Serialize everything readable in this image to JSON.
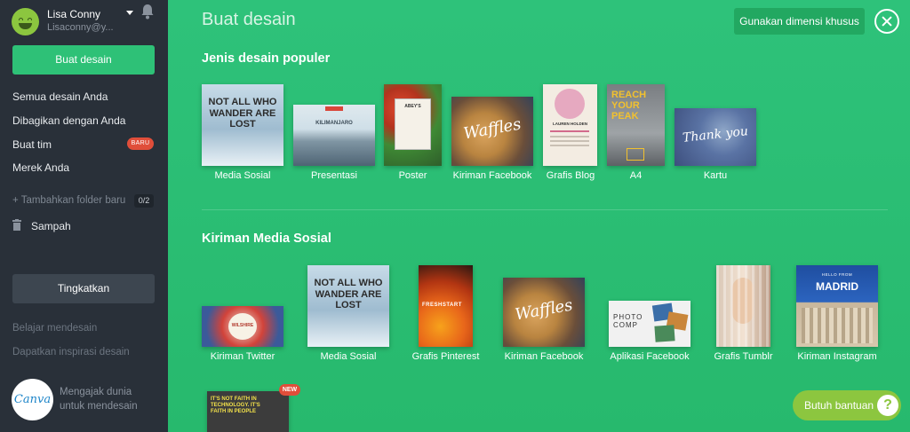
{
  "sidebar": {
    "user": {
      "name": "Lisa Conny",
      "email": "Lisaconny@y..."
    },
    "create_button": "Buat desain",
    "nav": [
      {
        "label": "Semua desain Anda"
      },
      {
        "label": "Dibagikan dengan Anda"
      },
      {
        "label": "Buat tim",
        "badge": "BARU"
      },
      {
        "label": "Merek Anda"
      }
    ],
    "add_folder": "+ Tambahkan folder baru",
    "folder_count": "0/2",
    "trash": "Sampah",
    "upgrade_button": "Tingkatkan",
    "learn": "Belajar mendesain",
    "inspiration": "Dapatkan inspirasi desain",
    "canva_logo": "Canva",
    "invite": "Mengajak dunia untuk mendesain"
  },
  "main": {
    "title": "Buat desain",
    "custom_button": "Gunakan dimensi khusus",
    "popular_title": "Jenis desain populer",
    "popular": [
      {
        "label": "Media Sosial",
        "text": "NOT ALL WHO WANDER ARE LOST"
      },
      {
        "label": "Presentasi",
        "text": "KILIMANJARO"
      },
      {
        "label": "Poster",
        "text": "ABEY'S"
      },
      {
        "label": "Kiriman Facebook",
        "text": "Waffles"
      },
      {
        "label": "Grafis Blog",
        "text": "LAUREN HOLDEN"
      },
      {
        "label": "A4",
        "text": "REACH YOUR PEAK"
      },
      {
        "label": "Kartu",
        "text": "Thank you"
      }
    ],
    "social_title": "Kiriman Media Sosial",
    "social": [
      {
        "label": "Kiriman Twitter",
        "text": "WILSHIRE"
      },
      {
        "label": "Media Sosial",
        "text": "NOT ALL WHO WANDER ARE LOST"
      },
      {
        "label": "Grafis Pinterest",
        "text": "FRESHSTART"
      },
      {
        "label": "Kiriman Facebook",
        "text": "Waffles"
      },
      {
        "label": "Aplikasi Facebook",
        "text": "PHOTO COMP"
      },
      {
        "label": "Grafis Tumblr",
        "text": ""
      },
      {
        "label": "Kiriman Instagram",
        "text": "MADRID",
        "subtext": "HELLO FROM"
      }
    ],
    "third_row": [
      {
        "text": "IT'S NOT FAITH IN TECHNOLOGY. IT'S FAITH IN PEOPLE",
        "badge": "NEW"
      }
    ]
  },
  "help": {
    "label": "Butuh bantuan",
    "icon": "?"
  },
  "colors": {
    "sidebar": "#293039",
    "main": "#2bbf73",
    "accent": "#2ec177",
    "badge": "#e04e3a",
    "help": "#8cc63f"
  }
}
